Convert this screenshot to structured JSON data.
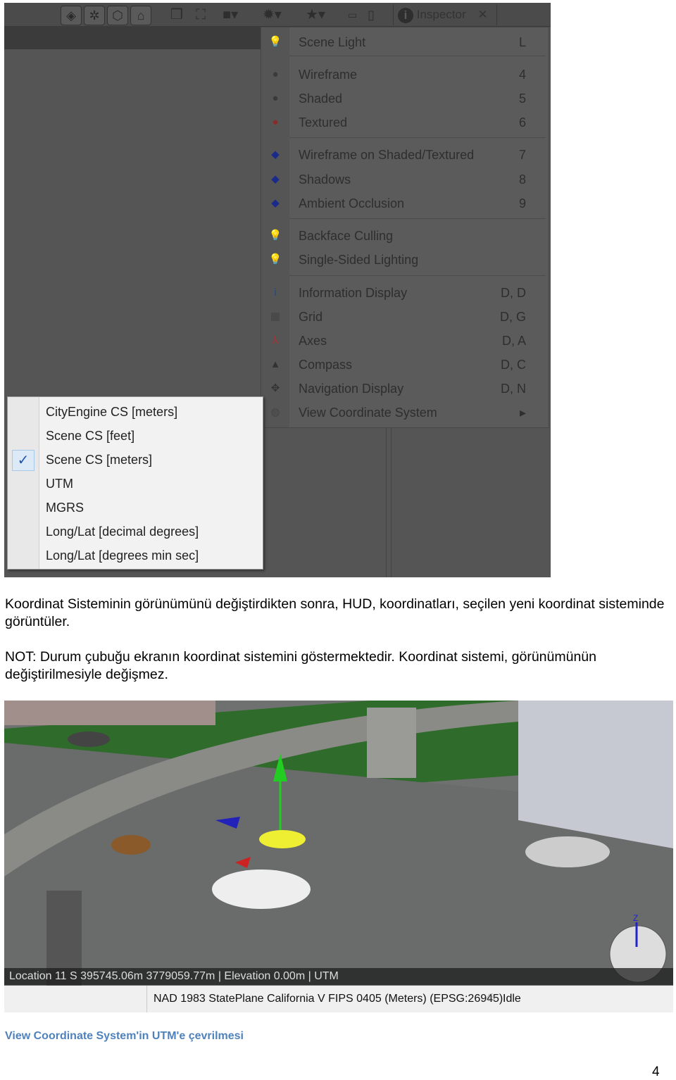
{
  "toolbar": {
    "inspector_label": "Inspector",
    "icons": [
      "layer-icon",
      "network-icon",
      "shape-icon",
      "model-icon",
      "objects-icon",
      "frame-icon",
      "camera-icon",
      "light-icon",
      "bookmark-icon",
      "minimize-icon",
      "maximize-icon"
    ]
  },
  "menu": {
    "groups": [
      [
        {
          "label": "Scene Light",
          "shortcut": "L",
          "icon": "bulb-icon"
        }
      ],
      [
        {
          "label": "Wireframe",
          "shortcut": "4",
          "icon": "sphere-icon"
        },
        {
          "label": "Shaded",
          "shortcut": "5",
          "icon": "sphere-icon"
        },
        {
          "label": "Textured",
          "shortcut": "6",
          "icon": "textured-sphere-icon"
        }
      ],
      [
        {
          "label": "Wireframe on Shaded/Textured",
          "shortcut": "7",
          "icon": "cube-icon"
        },
        {
          "label": "Shadows",
          "shortcut": "8",
          "icon": "cube-icon"
        },
        {
          "label": "Ambient Occlusion",
          "shortcut": "9",
          "icon": "cube-icon"
        }
      ],
      [
        {
          "label": "Backface Culling",
          "shortcut": "",
          "icon": "bulb-icon"
        },
        {
          "label": "Single-Sided Lighting",
          "shortcut": "",
          "icon": "bulb-icon"
        }
      ],
      [
        {
          "label": "Information Display",
          "shortcut": "D, D",
          "icon": "info-icon"
        },
        {
          "label": "Grid",
          "shortcut": "D, G",
          "icon": "grid-icon"
        },
        {
          "label": "Axes",
          "shortcut": "D, A",
          "icon": "axes-icon"
        },
        {
          "label": "Compass",
          "shortcut": "D, C",
          "icon": "compass-icon"
        },
        {
          "label": "Navigation Display",
          "shortcut": "D, N",
          "icon": "navigation-icon"
        },
        {
          "label": "View Coordinate System",
          "shortcut": "▸",
          "icon": "globe-icon"
        }
      ]
    ]
  },
  "submenu": {
    "items": [
      {
        "label": "CityEngine CS [meters]",
        "checked": false
      },
      {
        "label": "Scene CS [feet]",
        "checked": false
      },
      {
        "label": "Scene CS [meters]",
        "checked": true
      },
      {
        "label": "UTM",
        "checked": false
      },
      {
        "label": "MGRS",
        "checked": false
      },
      {
        "label": "Long/Lat [decimal degrees]",
        "checked": false
      },
      {
        "label": "Long/Lat [degrees min sec]",
        "checked": false
      }
    ],
    "check": "✓"
  },
  "text": {
    "para1": "Koordinat Sisteminin görünümünü değiştirdikten sonra, HUD, koordinatları, seçilen yeni koordinat sisteminde görüntüler.",
    "para2": "NOT: Durum çubuğu ekranın koordinat sistemini göstermektedir. Koordinat sistemi, görünümünün değiştirilmesiyle değişmez.",
    "caption": "View Coordinate System'in UTM'e çevrilmesi",
    "page_number": "4"
  },
  "scene": {
    "hud": "Location 11 S 395745.06m 3779059.77m  |  Elevation 0.00m   |  UTM",
    "status_crs": "NAD 1983 StatePlane California V FIPS 0405 (Meters) (EPSG:26945)",
    "status_state": "Idle",
    "axis_label": "Z"
  },
  "colors": {
    "caption": "#4f81bd",
    "menu_bg": "#5b5b5b",
    "submenu_bg": "#f2f2f2"
  }
}
